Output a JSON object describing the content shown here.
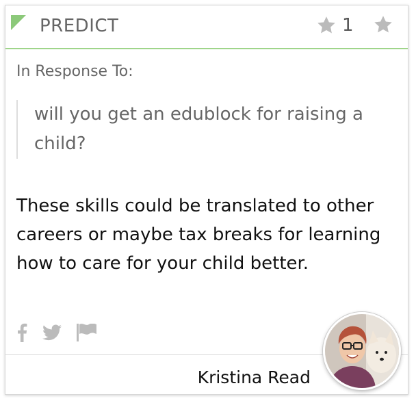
{
  "card": {
    "category": "PREDICT",
    "rating_count": "1",
    "response_label": "In Response To:",
    "quote": "will you get an edublock for raising a child?",
    "body": "These skills could be translated to other careers or maybe tax breaks for learning how to care for your child better.",
    "author": "Kristina Read"
  },
  "icons": {
    "rating": "star-icon",
    "favorite": "star-icon",
    "share_facebook": "facebook-icon",
    "share_twitter": "twitter-icon",
    "report": "flag-icon"
  },
  "colors": {
    "accent": "#8cc97a",
    "header_rule": "#9fd58a",
    "icon_gray": "#bbbbbb"
  }
}
